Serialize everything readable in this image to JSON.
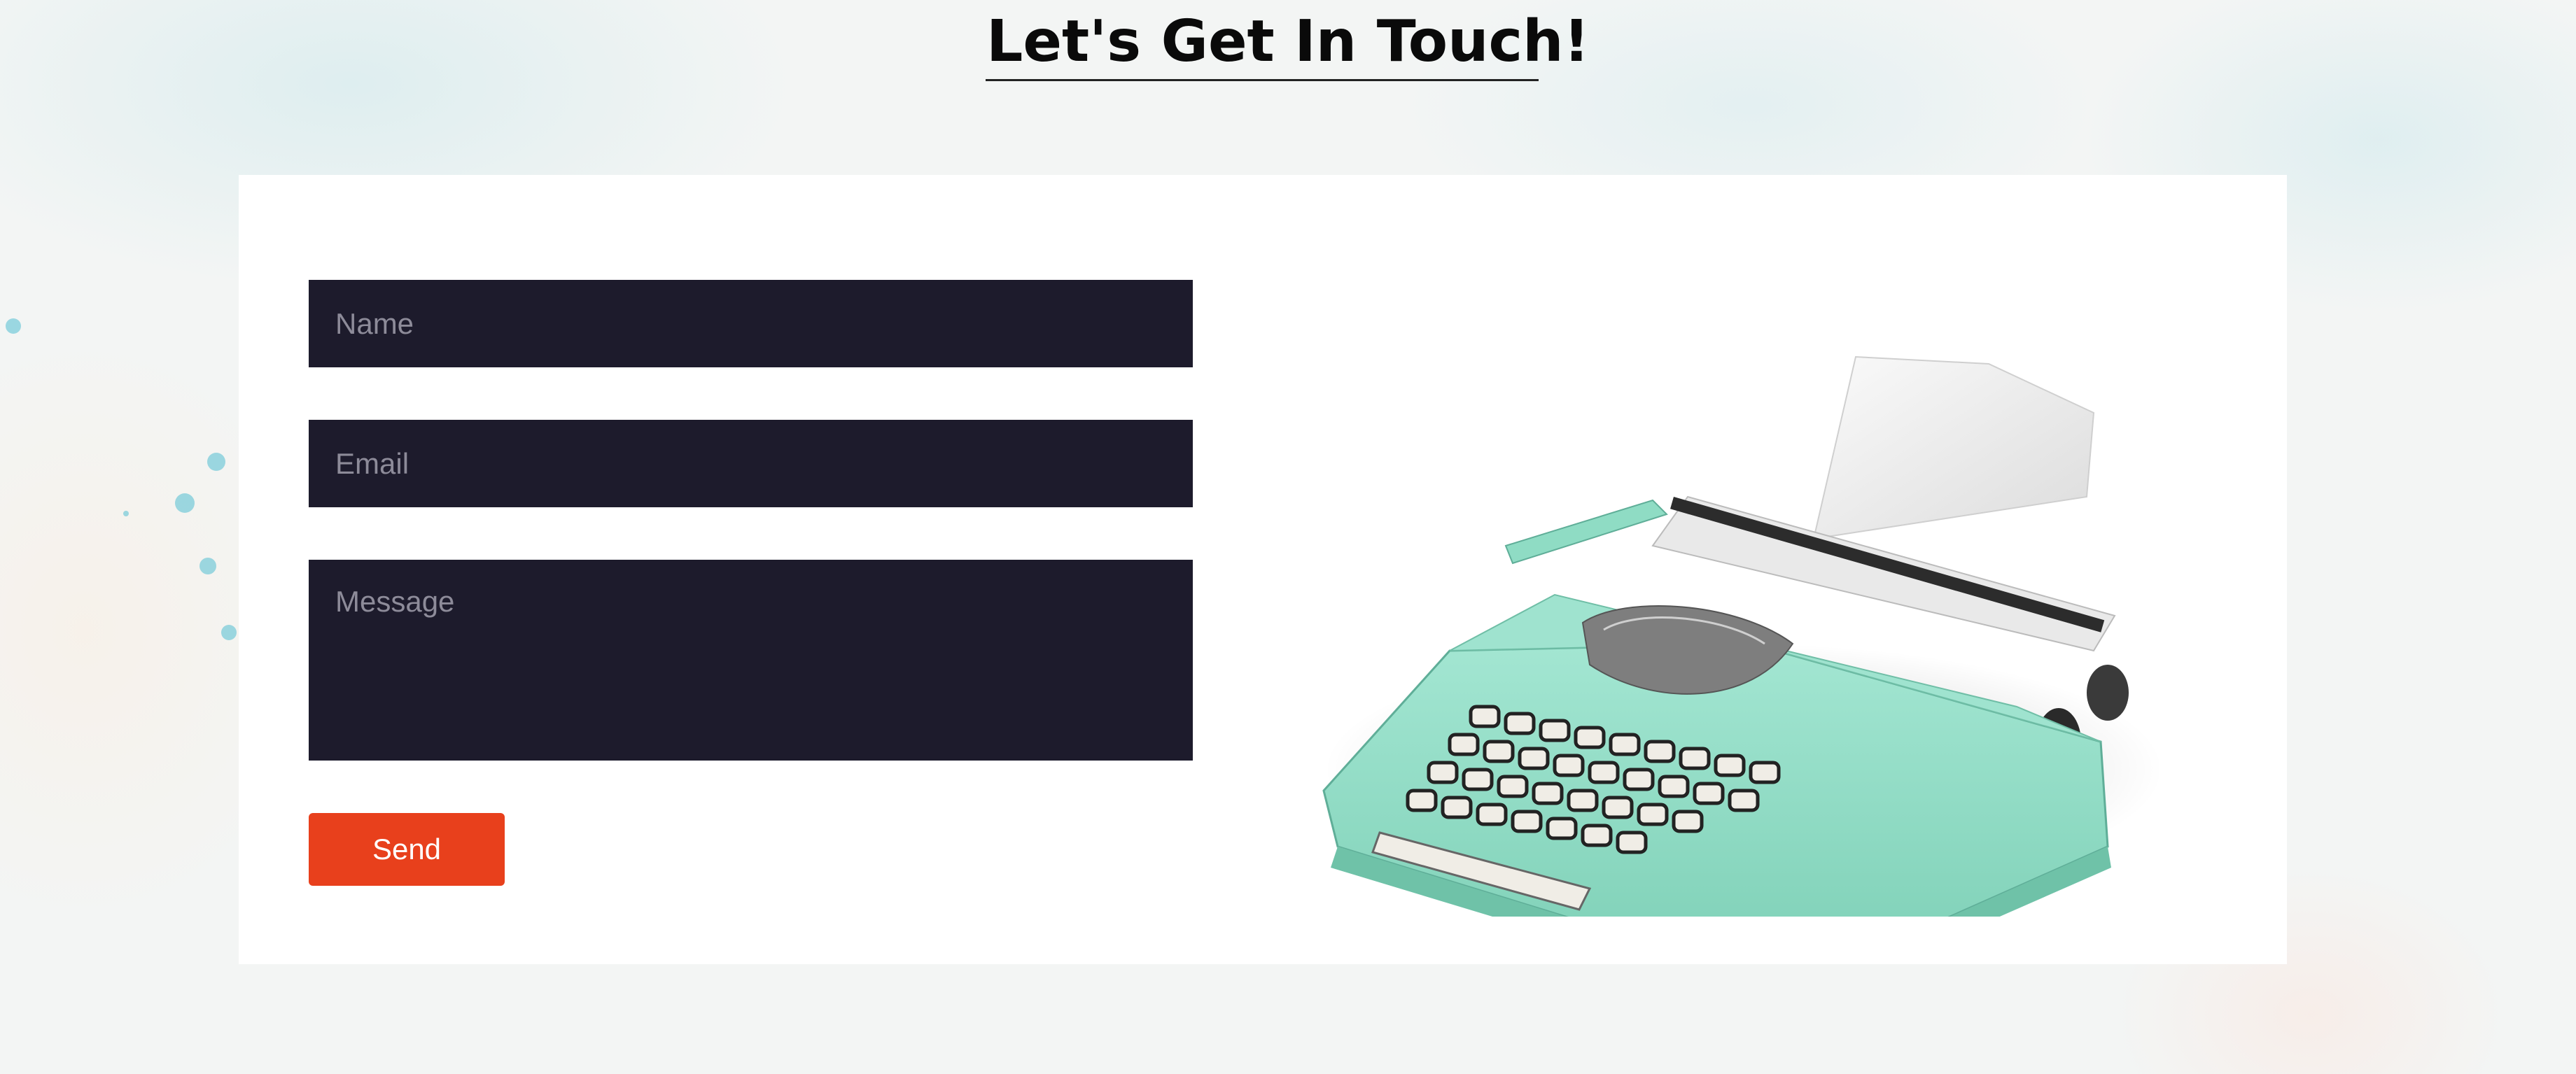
{
  "header": {
    "title": "Let's Get In Touch!"
  },
  "form": {
    "name_placeholder": "Name",
    "email_placeholder": "Email",
    "message_placeholder": "Message",
    "send_label": "Send"
  },
  "illustration": {
    "icon": "typewriter-image"
  },
  "colors": {
    "field_bg": "#1d1b2c",
    "button_bg": "#e8401c",
    "typewriter_body": "#8fdcc4"
  }
}
